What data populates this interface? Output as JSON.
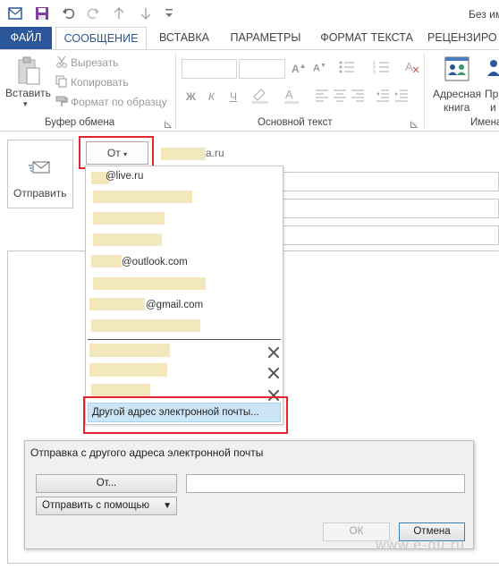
{
  "window": {
    "title": "Без им"
  },
  "tabs": [
    "ФАЙЛ",
    "СООБЩЕНИЕ",
    "ВСТАВКА",
    "ПАРАМЕТРЫ",
    "ФОРМАТ ТЕКСТА",
    "РЕЦЕНЗИРО"
  ],
  "ribbon": {
    "paste": "Вставить",
    "cut": "Вырезать",
    "copy": "Копировать",
    "format_painter": "Формат по образцу",
    "clipboard_group": "Буфер обмена",
    "basic_text_group": "Основной текст",
    "address_book": "Адресная",
    "address_book2": "книга",
    "next_partial": "Пр",
    "next_partial2": "и",
    "names_group_partial": "Имена"
  },
  "compose": {
    "send": "Отправить",
    "from_button": "От",
    "from_domain_suffix": "a.ru"
  },
  "from_dropdown": {
    "accounts": [
      "@live.ru",
      "@outlook.com",
      "@gmail.com"
    ],
    "other_address": "Другой адрес электронной почты..."
  },
  "dialog": {
    "title": "Отправка с другого адреса электронной почты",
    "from_button": "От...",
    "send_via": "Отправить с помощью",
    "ok": "ОК",
    "cancel": "Отмена"
  },
  "watermark": "www.e-du.ru",
  "colors": {
    "accent": "#2b579a",
    "highlight_red": "#e3252e",
    "redaction": "#f3e8bc",
    "selected": "#cde6f7"
  }
}
